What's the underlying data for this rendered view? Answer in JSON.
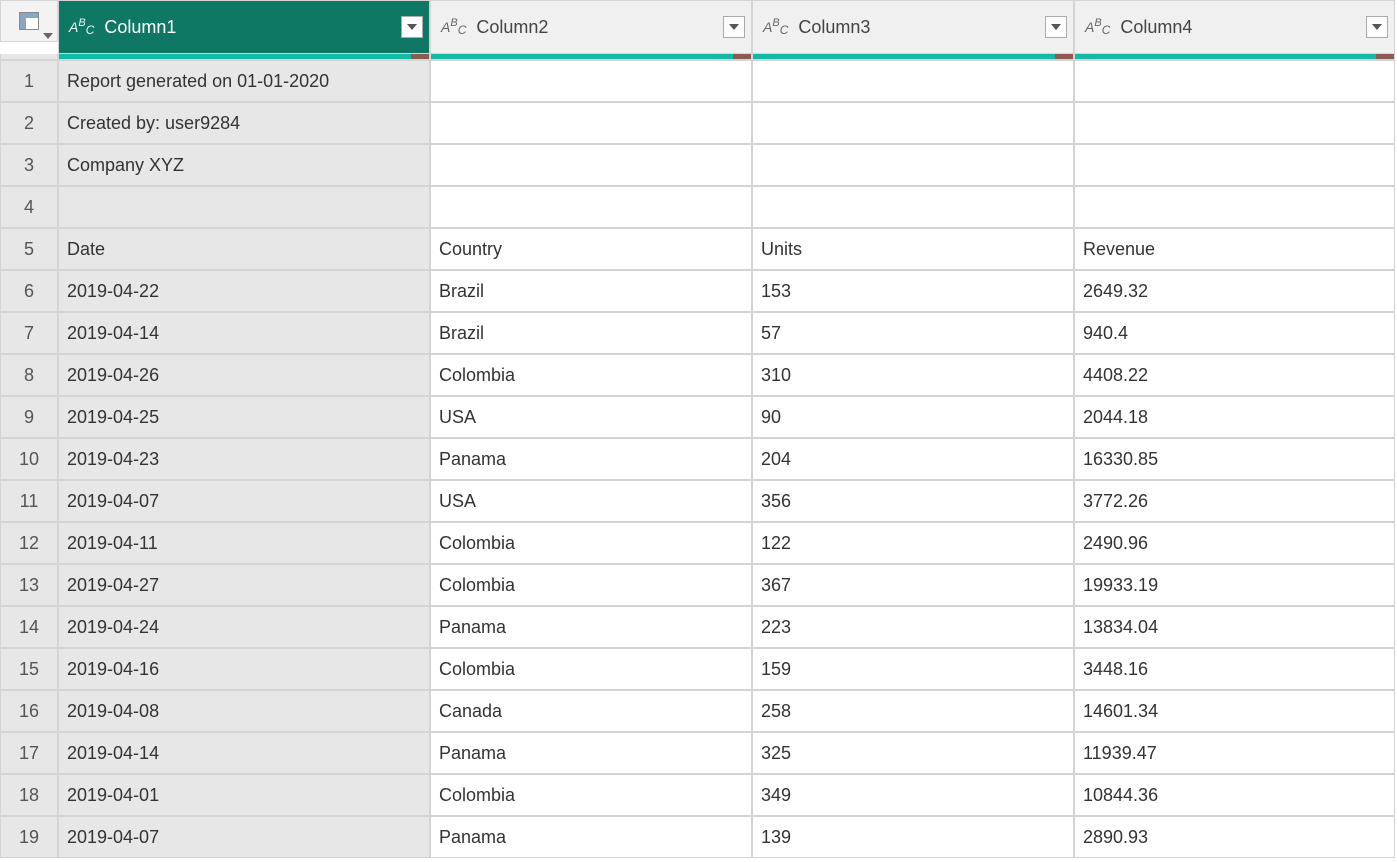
{
  "columns": [
    {
      "label": "Column1",
      "selected": true
    },
    {
      "label": "Column2",
      "selected": false
    },
    {
      "label": "Column3",
      "selected": false
    },
    {
      "label": "Column4",
      "selected": false
    }
  ],
  "type_indicator": "ABC",
  "rows": [
    {
      "n": "1",
      "c1": "Report generated on 01-01-2020",
      "c2": "",
      "c3": "",
      "c4": ""
    },
    {
      "n": "2",
      "c1": "Created by: user9284",
      "c2": "",
      "c3": "",
      "c4": ""
    },
    {
      "n": "3",
      "c1": "Company XYZ",
      "c2": "",
      "c3": "",
      "c4": ""
    },
    {
      "n": "4",
      "c1": "",
      "c2": "",
      "c3": "",
      "c4": ""
    },
    {
      "n": "5",
      "c1": "Date",
      "c2": "Country",
      "c3": "Units",
      "c4": "Revenue"
    },
    {
      "n": "6",
      "c1": "2019-04-22",
      "c2": "Brazil",
      "c3": "153",
      "c4": "2649.32"
    },
    {
      "n": "7",
      "c1": "2019-04-14",
      "c2": "Brazil",
      "c3": "57",
      "c4": "940.4"
    },
    {
      "n": "8",
      "c1": "2019-04-26",
      "c2": "Colombia",
      "c3": "310",
      "c4": "4408.22"
    },
    {
      "n": "9",
      "c1": "2019-04-25",
      "c2": "USA",
      "c3": "90",
      "c4": "2044.18"
    },
    {
      "n": "10",
      "c1": "2019-04-23",
      "c2": "Panama",
      "c3": "204",
      "c4": "16330.85"
    },
    {
      "n": "11",
      "c1": "2019-04-07",
      "c2": "USA",
      "c3": "356",
      "c4": "3772.26"
    },
    {
      "n": "12",
      "c1": "2019-04-11",
      "c2": "Colombia",
      "c3": "122",
      "c4": "2490.96"
    },
    {
      "n": "13",
      "c1": "2019-04-27",
      "c2": "Colombia",
      "c3": "367",
      "c4": "19933.19"
    },
    {
      "n": "14",
      "c1": "2019-04-24",
      "c2": "Panama",
      "c3": "223",
      "c4": "13834.04"
    },
    {
      "n": "15",
      "c1": "2019-04-16",
      "c2": "Colombia",
      "c3": "159",
      "c4": "3448.16"
    },
    {
      "n": "16",
      "c1": "2019-04-08",
      "c2": "Canada",
      "c3": "258",
      "c4": "14601.34"
    },
    {
      "n": "17",
      "c1": "2019-04-14",
      "c2": "Panama",
      "c3": "325",
      "c4": "11939.47"
    },
    {
      "n": "18",
      "c1": "2019-04-01",
      "c2": "Colombia",
      "c3": "349",
      "c4": "10844.36"
    },
    {
      "n": "19",
      "c1": "2019-04-07",
      "c2": "Panama",
      "c3": "139",
      "c4": "2890.93"
    }
  ]
}
